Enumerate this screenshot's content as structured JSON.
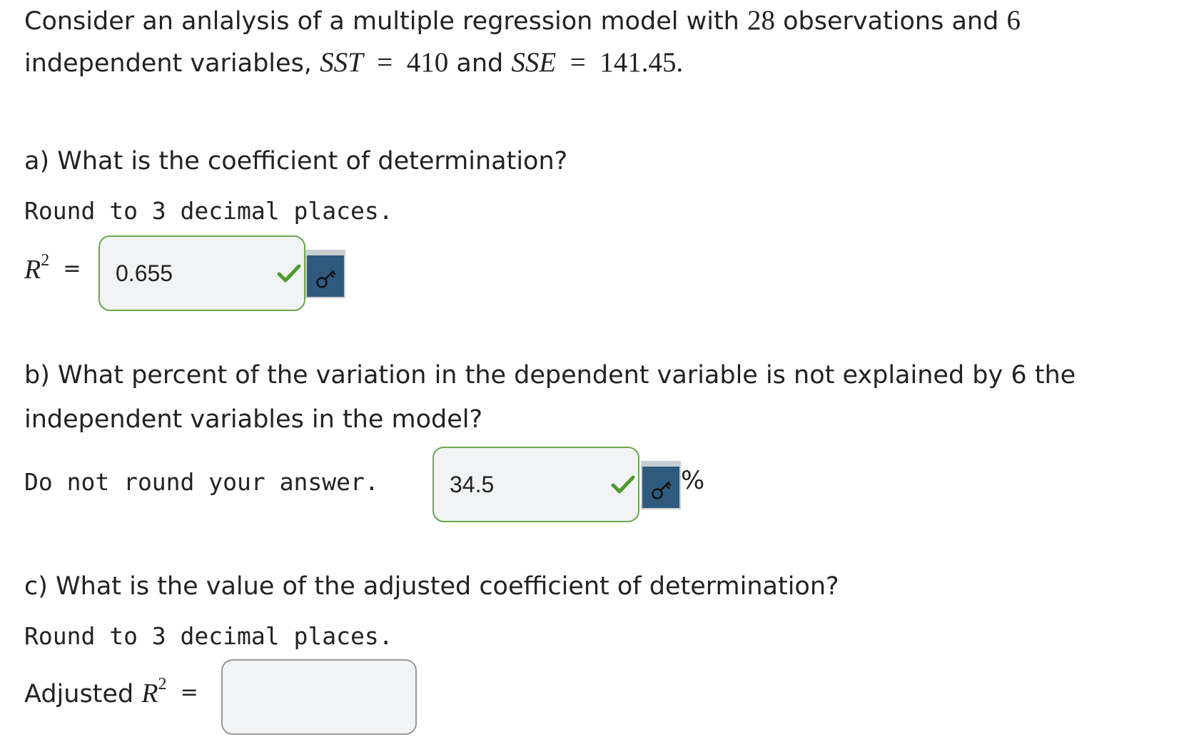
{
  "question": {
    "line1_prefix": "Consider an anlalysis of a multiple regression model with ",
    "n_obs": "28",
    "line1_mid": " observations and ",
    "n_vars": "6",
    "line2_prefix": "independent variables, ",
    "sst_symbol": "SST",
    "eq": "=",
    "sst_value": "410",
    "and_word": " and ",
    "sse_symbol": "SSE",
    "sse_value": "141.45."
  },
  "part_a": {
    "question": "a) What is the coefficient of determination?",
    "instruction": "Round to 3 decimal places.",
    "label_symbol": "R",
    "label_sup": "2",
    "label_eq": "=",
    "answer_value": "0.655",
    "status": "correct",
    "key_icon": "key-icon"
  },
  "part_b": {
    "question_line1": "b) What percent of the variation in the dependent variable is not explained by 6 the",
    "question_line2": "independent variables in the model?",
    "instruction": "Do not round your answer.",
    "answer_value": "34.5",
    "status": "correct",
    "unit": "%",
    "key_icon": "key-icon"
  },
  "part_c": {
    "question": "c) What is the value of the adjusted coefficient of determination?",
    "instruction": "Round to 3 decimal places.",
    "label_prefix": "Adjusted ",
    "label_symbol": "R",
    "label_sup": "2",
    "label_eq": "=",
    "answer_value": "",
    "status": "unanswered"
  },
  "colors": {
    "correct_border": "#6aa84f",
    "check": "#4f9a2e",
    "key_button": "#2f5a7e",
    "input_bg": "#f2f3f4"
  }
}
